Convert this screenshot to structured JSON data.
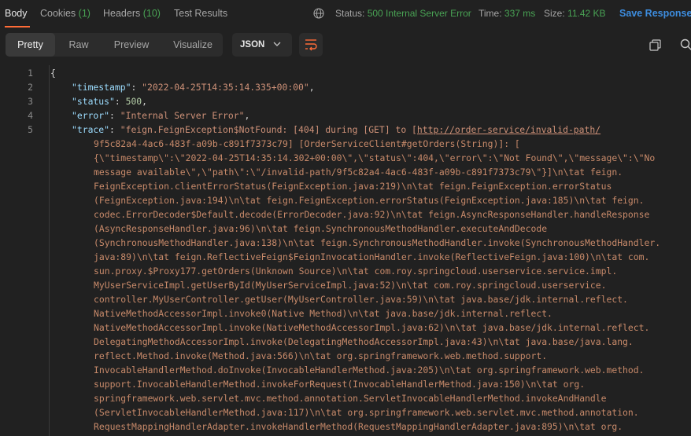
{
  "tabs": {
    "body": "Body",
    "cookies": "Cookies",
    "cookies_count": "(1)",
    "headers": "Headers",
    "headers_count": "(10)",
    "test_results": "Test Results"
  },
  "status": {
    "status_label": "Status:",
    "status_value": "500 Internal Server Error",
    "time_label": "Time:",
    "time_value": "337 ms",
    "size_label": "Size:",
    "size_value": "11.42 KB"
  },
  "save_response": "Save Response",
  "view_modes": [
    "Pretty",
    "Raw",
    "Preview",
    "Visualize"
  ],
  "format": "JSON",
  "icons": [
    "globe-icon",
    "chevron-down-icon",
    "wrap-icon",
    "copy-icon",
    "search-icon"
  ],
  "code": {
    "line_numbers": [
      "1",
      "2",
      "3",
      "4",
      "5"
    ],
    "open_brace": "{",
    "timestamp_key": "\"timestamp\"",
    "timestamp_value": "\"2022-04-25T14:35:14.335+00:00\"",
    "status_key": "\"status\"",
    "status_value": "500",
    "error_key": "\"error\"",
    "error_value": "\"Internal Server Error\"",
    "trace_key": "\"trace\"",
    "trace_prefix": "\"feign.FeignException$NotFound: [404] during [GET] to [",
    "trace_link": "http://order-service/invalid-path/",
    "trace_wrapped": [
      "9f5c82a4-4ac6-483f-a09b-c891f7373c79] [OrderServiceClient#getOrders(String)]: [",
      "{\\\"timestamp\\\":\\\"2022-04-25T14:35:14.302+00:00\\\",\\\"status\\\":404,\\\"error\\\":\\\"Not Found\\\",\\\"message\\\":\\\"No",
      "message available\\\",\\\"path\\\":\\\"/invalid-path/9f5c82a4-4ac6-483f-a09b-c891f7373c79\\\"}]\\n\\tat feign.",
      "FeignException.clientErrorStatus(FeignException.java:219)\\n\\tat feign.FeignException.errorStatus",
      "(FeignException.java:194)\\n\\tat feign.FeignException.errorStatus(FeignException.java:185)\\n\\tat feign.",
      "codec.ErrorDecoder$Default.decode(ErrorDecoder.java:92)\\n\\tat feign.AsyncResponseHandler.handleResponse",
      "(AsyncResponseHandler.java:96)\\n\\tat feign.SynchronousMethodHandler.executeAndDecode",
      "(SynchronousMethodHandler.java:138)\\n\\tat feign.SynchronousMethodHandler.invoke(SynchronousMethodHandler.",
      "java:89)\\n\\tat feign.ReflectiveFeign$FeignInvocationHandler.invoke(ReflectiveFeign.java:100)\\n\\tat com.",
      "sun.proxy.$Proxy177.getOrders(Unknown Source)\\n\\tat com.roy.springcloud.userservice.service.impl.",
      "MyUserServiceImpl.getUserById(MyUserServiceImpl.java:52)\\n\\tat com.roy.springcloud.userservice.",
      "controller.MyUserController.getUser(MyUserController.java:59)\\n\\tat java.base/jdk.internal.reflect.",
      "NativeMethodAccessorImpl.invoke0(Native Method)\\n\\tat java.base/jdk.internal.reflect.",
      "NativeMethodAccessorImpl.invoke(NativeMethodAccessorImpl.java:62)\\n\\tat java.base/jdk.internal.reflect.",
      "DelegatingMethodAccessorImpl.invoke(DelegatingMethodAccessorImpl.java:43)\\n\\tat java.base/java.lang.",
      "reflect.Method.invoke(Method.java:566)\\n\\tat org.springframework.web.method.support.",
      "InvocableHandlerMethod.doInvoke(InvocableHandlerMethod.java:205)\\n\\tat org.springframework.web.method.",
      "support.InvocableHandlerMethod.invokeForRequest(InvocableHandlerMethod.java:150)\\n\\tat org.",
      "springframework.web.servlet.mvc.method.annotation.ServletInvocableHandlerMethod.invokeAndHandle",
      "(ServletInvocableHandlerMethod.java:117)\\n\\tat org.springframework.web.servlet.mvc.method.annotation.",
      "RequestMappingHandlerAdapter.invokeHandlerMethod(RequestMappingHandlerAdapter.java:895)\\n\\tat org."
    ]
  }
}
